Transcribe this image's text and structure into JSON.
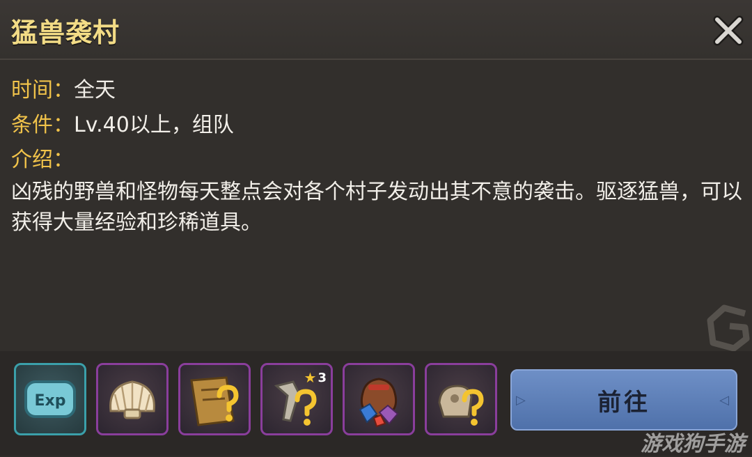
{
  "header": {
    "title": "猛兽袭村"
  },
  "info": {
    "time_label": "时间：",
    "time_value": "全天",
    "cond_label": "条件：",
    "cond_value": "Lv.40以上，组队",
    "intro_label": "介绍："
  },
  "description": "凶残的野兽和怪物每天整点会对各个村子发动出其不意的袭击。驱逐猛兽，可以获得大量经验和珍稀道具。",
  "rewards": [
    {
      "icon": "exp-icon",
      "text": "Exp"
    },
    {
      "icon": "shell-icon"
    },
    {
      "icon": "mystery-scroll-icon"
    },
    {
      "icon": "mystery-weapon-icon",
      "stars": "3"
    },
    {
      "icon": "gem-bag-icon"
    },
    {
      "icon": "mystery-item-icon"
    }
  ],
  "go_button": "前往",
  "watermark": "游戏狗手游",
  "colors": {
    "label": "#f1c34a",
    "title": "#f3dc86",
    "button": "#5f80b8",
    "slot_border": "#8a3e9c",
    "exp_border": "#3ba0aa"
  }
}
